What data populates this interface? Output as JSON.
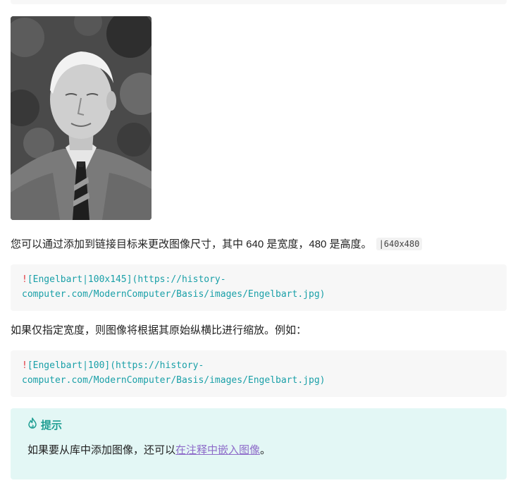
{
  "image": {
    "alt": "Engelbart"
  },
  "paragraph_resize": {
    "text": "您可以通过添加到链接目标来更改图像尺寸，其中 640 是宽度，480 是高度。",
    "code": "|640x480"
  },
  "code_resize": {
    "bang": "!",
    "line1": "[Engelbart|100x145](https://history-",
    "line2": "computer.com/ModernComputer/Basis/images/Engelbart.jpg)"
  },
  "paragraph_width": {
    "text": "如果仅指定宽度，则图像将根据其原始纵横比进行缩放。例如："
  },
  "code_width": {
    "bang": "!",
    "line1": "[Engelbart|100](https://history-",
    "line2": "computer.com/ModernComputer/Basis/images/Engelbart.jpg)"
  },
  "tip": {
    "icon": "flame-icon",
    "title": "提示",
    "text_before": "如果要从库中添加图像，还可以",
    "link": "在注释中嵌入图像",
    "text_after": "。"
  },
  "colors": {
    "code_text": "#1aa0a8",
    "code_bang": "#e0383e",
    "tip_background": "#e3f7f5",
    "tip_accent": "#1f9e93",
    "link": "#8e6cc9"
  }
}
